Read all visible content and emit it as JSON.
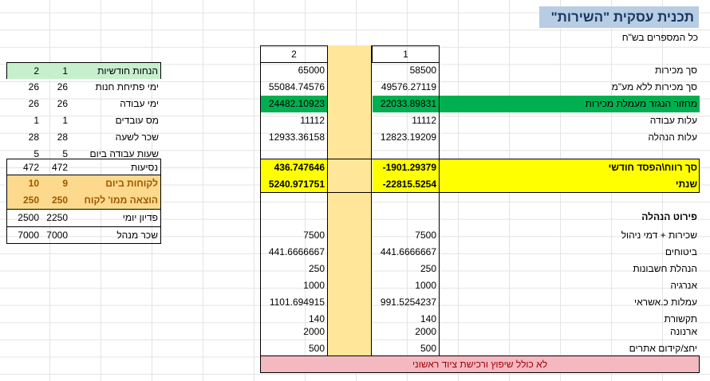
{
  "title": "תכנית עסקית \"השירות\"",
  "subtitle": "כל המספרים בש\"ח",
  "left_table": {
    "rows": [
      {
        "label": "הנחות חודשיות",
        "v1": "1",
        "v2": "2"
      },
      {
        "label": "ימי פתיחת חנות",
        "v1": "26",
        "v2": "26"
      },
      {
        "label": "ימי עבודה",
        "v1": "26",
        "v2": "26"
      },
      {
        "label": "מס עובדים",
        "v1": "1",
        "v2": "1"
      },
      {
        "label": "שכר לשעה",
        "v1": "28",
        "v2": "28"
      },
      {
        "label": "שעות עבודה ביום",
        "v1": "5",
        "v2": "5"
      },
      {
        "label": "נסיעות",
        "v1": "472",
        "v2": "472"
      },
      {
        "label": "לקוחות ביום",
        "v1": "9",
        "v2": "10"
      },
      {
        "label": "הוצאה ממו' לקוח",
        "v1": "250",
        "v2": "250"
      },
      {
        "label": "פדיון יומי",
        "v1": "2250",
        "v2": "2500"
      },
      {
        "label": "שכר מנהל",
        "v1": "7000",
        "v2": "7000"
      }
    ]
  },
  "main_table": {
    "headers": {
      "col1": "1",
      "col2": "2"
    },
    "rows": [
      {
        "label": "סך מכירות",
        "c1": "58500",
        "c2": "65000"
      },
      {
        "label": "סך מכירות ללא מע\"מ",
        "c1": "49576.27119",
        "c2": "55084.74576"
      },
      {
        "label": "מחזור הנגזר מעמלת מכירות",
        "c1": "22033.89831",
        "c2": "24482.10923"
      },
      {
        "label": "עלות עבודה",
        "c1": "11112",
        "c2": "11112"
      },
      {
        "label": "עלות הנהלה",
        "c1": "12823.19209",
        "c2": "12933.36158"
      },
      {
        "label": "סך רווח\\הפסד חודשי",
        "c1": "-1901.29379",
        "c2": "436.747646"
      },
      {
        "label": "שנתי",
        "c1": "-22815.5254",
        "c2": "5240.971751"
      },
      {
        "label": "פירוט הנהלה",
        "c1": "",
        "c2": ""
      },
      {
        "label": "שכירות + דמי ניהול",
        "c1": "7500",
        "c2": "7500"
      },
      {
        "label": "ביטוחים",
        "c1": "441.6666667",
        "c2": "441.6666667"
      },
      {
        "label": "הנהלת חשבונות",
        "c1": "250",
        "c2": "250"
      },
      {
        "label": "אנרגיה",
        "c1": "1000",
        "c2": "1000"
      },
      {
        "label": "עמלות כ.אשראי",
        "c1": "991.5254237",
        "c2": "1101.694915"
      },
      {
        "label": "תקשורת",
        "c1": "140",
        "c2": "140"
      },
      {
        "label": "ארנונה",
        "c1": "2000",
        "c2": "2000"
      },
      {
        "label": "יחצ/קידום אתרים",
        "c1": "500",
        "c2": "500"
      }
    ],
    "footer": "לא כולל שיפוץ ורכישת ציוד ראשוני"
  },
  "colors": {
    "title_bg": "#b8cce4",
    "green": "#00b050",
    "light_green": "#c6efce",
    "yellow": "#ffff00",
    "gold": "#fcd98c",
    "yellow_column": "#ffe699",
    "pink": "#f4b8c0"
  }
}
